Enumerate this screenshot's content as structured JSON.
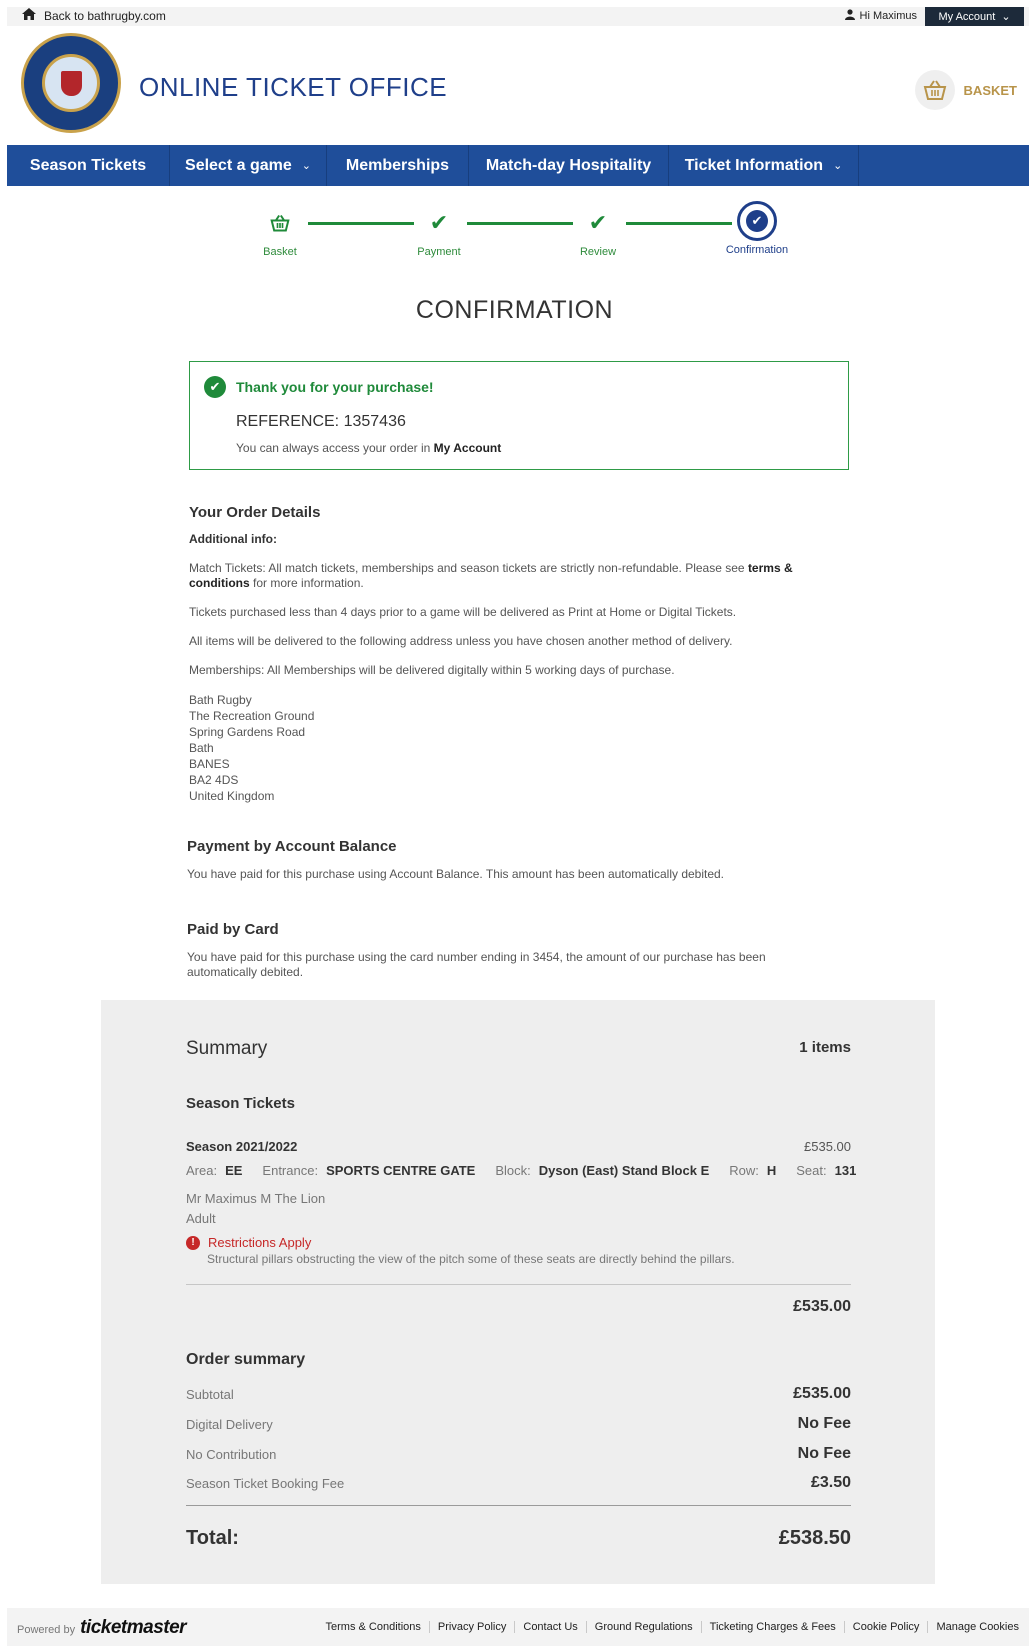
{
  "topbar": {
    "back_label": "Back to bathrugby.com",
    "greeting": "Hi Maximus",
    "account_label": "My Account"
  },
  "header": {
    "site_title": "ONLINE TICKET OFFICE",
    "basket_label": "BASKET"
  },
  "nav": {
    "items": [
      {
        "label": "Season Tickets"
      },
      {
        "label": "Select a game"
      },
      {
        "label": "Memberships"
      },
      {
        "label": "Match-day Hospitality"
      },
      {
        "label": "Ticket Information"
      }
    ]
  },
  "steps": {
    "items": [
      {
        "label": "Basket",
        "state": "done"
      },
      {
        "label": "Payment",
        "state": "done"
      },
      {
        "label": "Review",
        "state": "done"
      },
      {
        "label": "Confirmation",
        "state": "active"
      }
    ]
  },
  "page_title": "CONFIRMATION",
  "confirmation": {
    "thanks": "Thank you for your purchase!",
    "reference": "REFERENCE: 1357436",
    "note_prefix": "You can always access your order in",
    "note_link": "My Account"
  },
  "order_details": {
    "heading": "Your Order Details",
    "additional_info": "Additional info:",
    "p1_text": "Match Tickets: All match tickets, memberships and season tickets are strictly non-refundable. Please see",
    "p1_link": "terms & conditions",
    "p1_suffix": "for more information.",
    "p2": "Tickets purchased less than 4 days prior to a game will be delivered as Print at Home or Digital Tickets.",
    "p3": "All items will be delivered to the following address unless you have chosen another method of delivery.",
    "p4": "Memberships: All Memberships will be delivered digitally within 5 working days of purchase.",
    "address": [
      "Bath Rugby",
      "The Recreation Ground",
      "Spring Gardens Road",
      "Bath",
      "BANES",
      "BA2 4DS",
      "United Kingdom"
    ]
  },
  "payment_balance": {
    "heading": "Payment by Account Balance",
    "text": "You have paid for this purchase using Account Balance. This amount has been automatically debited."
  },
  "paid_card": {
    "heading": "Paid by Card",
    "text": "You have paid for this purchase using the card number ending in 3454, the amount of our purchase has been automatically debited."
  },
  "summary": {
    "heading": "Summary",
    "count": "1 items",
    "section": "Season Tickets",
    "season": "Season 2021/2022",
    "price": "£535.00",
    "area_label": "Area:",
    "area": "EE",
    "entrance_label": "Entrance:",
    "entrance": "SPORTS CENTRE GATE",
    "block_label": "Block:",
    "block": "Dyson (East) Stand Block E",
    "row_label": "Row:",
    "row": "H",
    "seat_label": "Seat:",
    "seat": "131",
    "holder": "Mr Maximus M The Lion",
    "holder_type": "Adult",
    "restriction_title": "Restrictions Apply",
    "restriction_text": "Structural pillars obstructing the view of the pitch some of these seats are directly behind the pillars.",
    "line_total": "£535.00",
    "order_summary_heading": "Order summary",
    "rows": [
      {
        "label": "Subtotal",
        "value": "£535.00"
      },
      {
        "label": "Digital Delivery",
        "value": "No Fee"
      },
      {
        "label": "No Contribution",
        "value": "No Fee"
      },
      {
        "label": "Season Ticket Booking Fee",
        "value": "£3.50"
      }
    ],
    "total_label": "Total:",
    "total_value": "£538.50"
  },
  "footer": {
    "powered_by": "Powered by",
    "brand": "ticketmaster",
    "links": [
      "Terms & Conditions",
      "Privacy Policy",
      "Contact Us",
      "Ground Regulations",
      "Ticketing Charges & Fees",
      "Cookie Policy",
      "Manage Cookies"
    ]
  },
  "colors": {
    "brand_blue": "#1f4e9a",
    "success_green": "#1f8a3a",
    "basket_gold": "#b8944a",
    "error_red": "#c62828"
  }
}
